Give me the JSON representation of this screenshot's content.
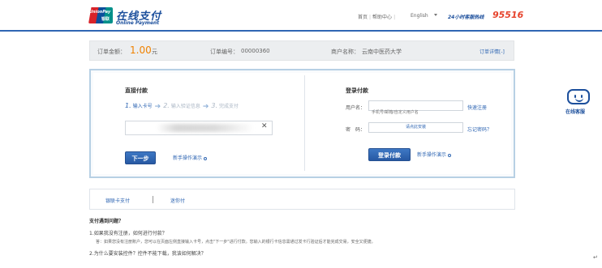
{
  "header": {
    "brand_cn": "在线支付",
    "brand_en": "Online Payment",
    "logo_text_en": "UnionPay",
    "logo_text_cn": "银联",
    "links": [
      "首页",
      "帮助中心"
    ],
    "language": "English",
    "hotline_label": "24小时客服热线",
    "hotline_number": "95516"
  },
  "order": {
    "amount_label": "订单金额：",
    "amount": "1.00",
    "currency": "元",
    "number_label": "订单编号：",
    "number": "00000360",
    "merchant_label": "商户名称：",
    "merchant": "云南中医药大学",
    "detail_link": "订单详情[-]"
  },
  "direct_pay": {
    "title": "直接付款",
    "steps": [
      {
        "num": "1.",
        "label": "输入卡号"
      },
      {
        "num": "2.",
        "label": "输入验证信息"
      },
      {
        "num": "3.",
        "label": "完成支付"
      }
    ],
    "card_placeholder": "",
    "next_button": "下一步",
    "help_link": "新手操作演示"
  },
  "login_pay": {
    "title": "登录付款",
    "username_label": "用户名：",
    "username_placeholder": "手机号/邮箱/自定义用户名",
    "register_link": "快速注册",
    "password_label": "密　码：",
    "password_prompt": "请点此安装",
    "forgot_link": "忘记密码？",
    "login_button": "登录付款",
    "help_link": "新手操作演示"
  },
  "tabs": {
    "items": [
      "银联卡支付",
      "迷你付"
    ]
  },
  "faq": {
    "title": "支付遇到问题？",
    "q1": "1.如果我没有注册，如何进行付款？",
    "a1": "答：如果您没有注册账户，您可以在页面左侧直接输入卡号，点击\"下一步\"进行付款。您输入的银行卡信息需通过发卡行验证后才能完成交易，安全又便捷。",
    "q2": "2.为什么要安装控件？控件不能下载，我该如何解决？"
  },
  "service_widget": {
    "label": "在线客服"
  },
  "colors": {
    "brand_blue": "#1c4f9c",
    "link_blue": "#2f66b3",
    "amount_orange": "#f08200",
    "hotline_red": "#e6432c"
  }
}
